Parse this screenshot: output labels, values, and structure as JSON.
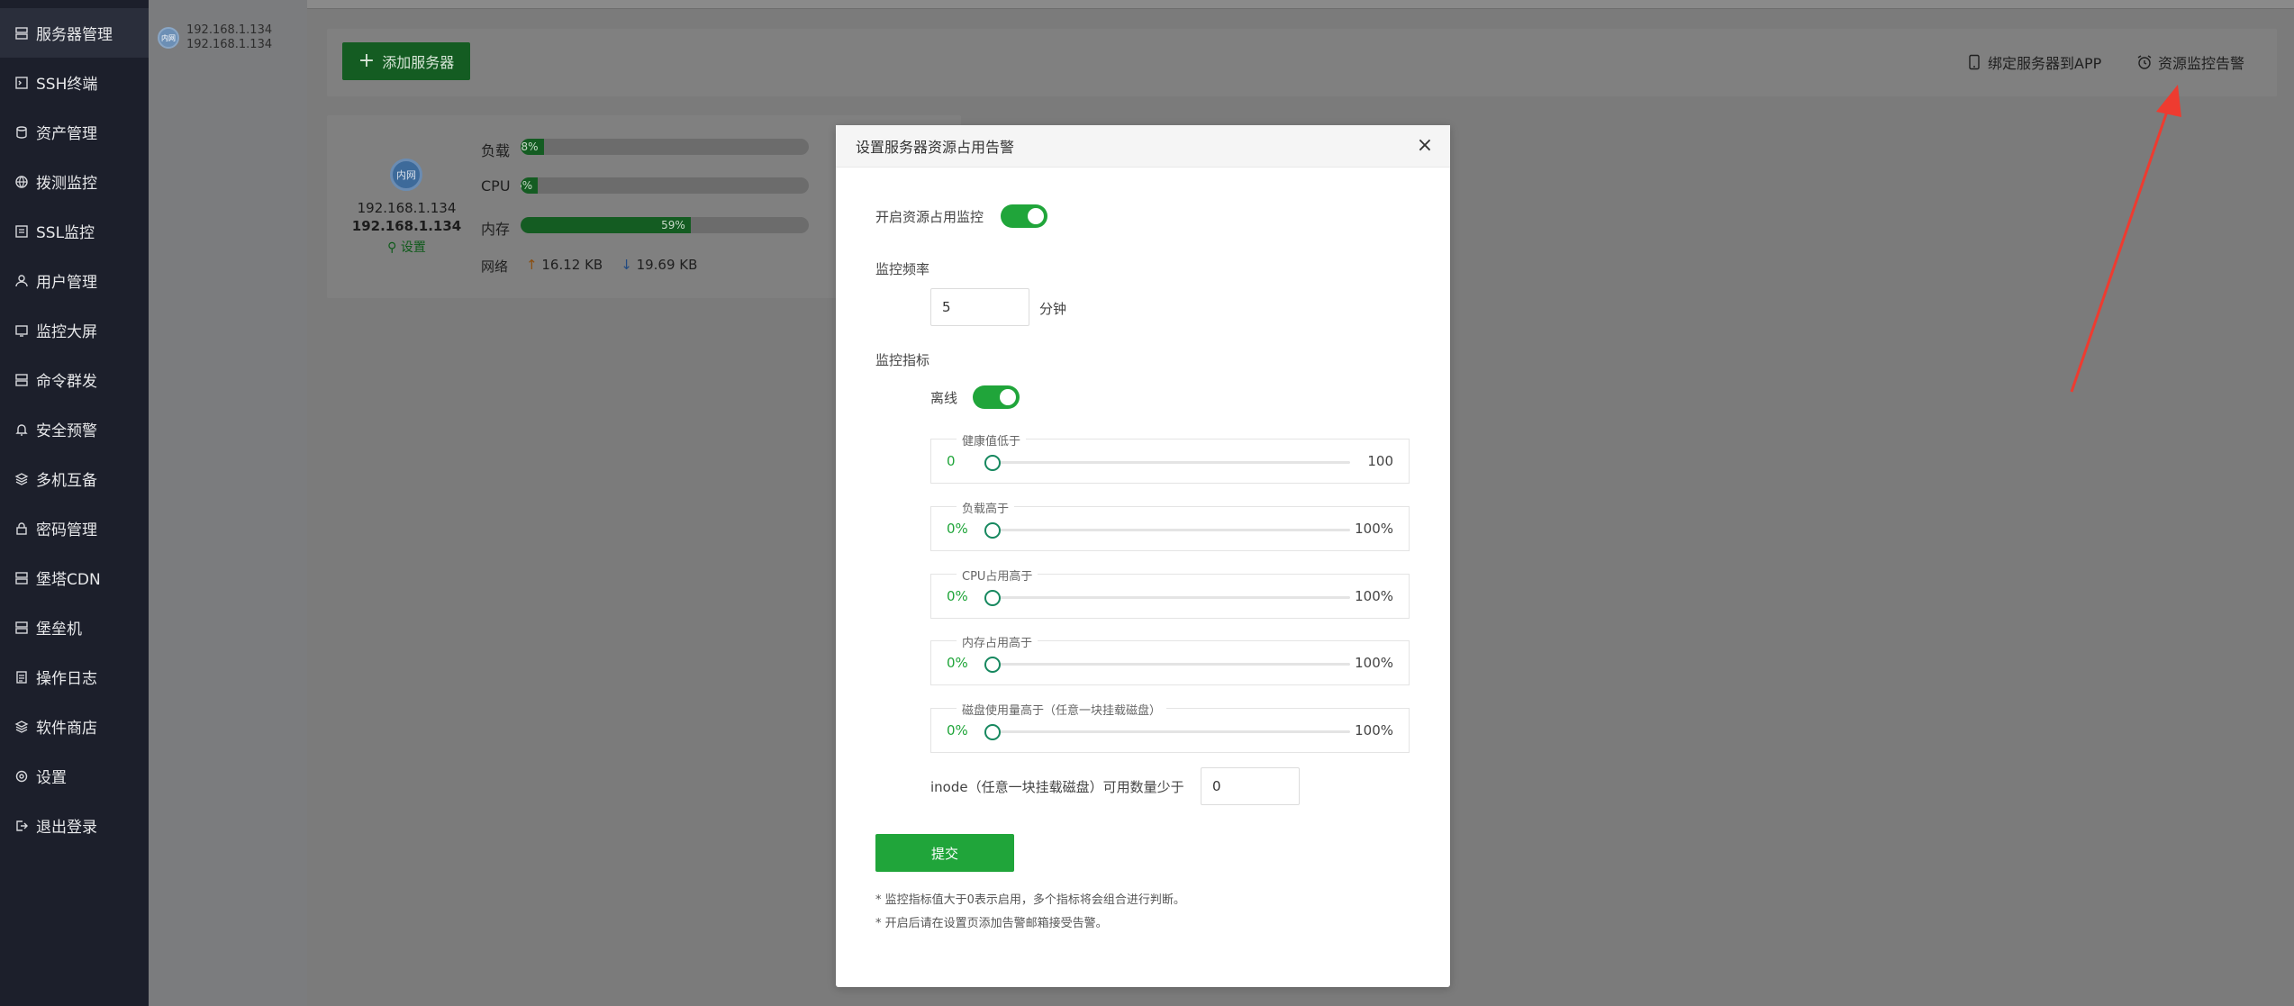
{
  "sidebar": {
    "items": [
      {
        "label": "服务器管理",
        "icon": "server-icon",
        "active": true
      },
      {
        "label": "SSH终端",
        "icon": "terminal-icon"
      },
      {
        "label": "资产管理",
        "icon": "database-icon"
      },
      {
        "label": "拨测监控",
        "icon": "globe-icon"
      },
      {
        "label": "SSL监控",
        "icon": "ssl-icon"
      },
      {
        "label": "用户管理",
        "icon": "user-icon"
      },
      {
        "label": "监控大屏",
        "icon": "dashboard-icon"
      },
      {
        "label": "命令群发",
        "icon": "command-icon"
      },
      {
        "label": "安全预警",
        "icon": "bell-icon"
      },
      {
        "label": "多机互备",
        "icon": "layers-icon"
      },
      {
        "label": "密码管理",
        "icon": "lock-icon"
      },
      {
        "label": "堡塔CDN",
        "icon": "cdn-icon"
      },
      {
        "label": "堡垒机",
        "icon": "bastion-icon"
      },
      {
        "label": "操作日志",
        "icon": "log-icon"
      },
      {
        "label": "软件商店",
        "icon": "store-icon"
      },
      {
        "label": "设置",
        "icon": "settings-icon"
      },
      {
        "label": "退出登录",
        "icon": "logout-icon"
      }
    ]
  },
  "server_list": {
    "badge": "内网",
    "ip_line1": "192.168.1.134",
    "ip_line2": "192.168.1.134"
  },
  "toolbar": {
    "add_server": "添加服务器",
    "bind_app": "绑定服务器到APP",
    "resource_alert": "资源监控告警"
  },
  "server_card": {
    "badge": "内网",
    "ip1": "192.168.1.134",
    "ip2": "192.168.1.134",
    "settings": "设置",
    "load_label": "负载",
    "load_value": "8%",
    "load_fraction": 0.08,
    "cpu_label": "CPU",
    "cpu_value": "6%",
    "cpu_fraction": 0.06,
    "mem_label": "内存",
    "mem_value": "59%",
    "mem_fraction": 0.59,
    "net_label": "网络",
    "net_up": "16.12 KB",
    "net_down": "19.69 KB"
  },
  "modal": {
    "title": "设置服务器资源占用告警",
    "enable_label": "开启资源占用监控",
    "freq_label": "监控频率",
    "freq_value": "5",
    "freq_unit": "分钟",
    "metrics_label": "监控指标",
    "offline_label": "离线",
    "ranges": [
      {
        "legend": "健康值低于",
        "min": "0",
        "max": "100",
        "value": 0
      },
      {
        "legend": "负载高于",
        "min": "0%",
        "max": "100%",
        "value": 0
      },
      {
        "legend": "CPU占用高于",
        "min": "0%",
        "max": "100%",
        "value": 0
      },
      {
        "legend": "内存占用高于",
        "min": "0%",
        "max": "100%",
        "value": 0
      },
      {
        "legend": "磁盘使用量高于（任意一块挂载磁盘）",
        "min": "0%",
        "max": "100%",
        "value": 0
      }
    ],
    "inode_label": "inode（任意一块挂载磁盘）可用数量少于",
    "inode_value": "0",
    "submit": "提交",
    "note1": "* 监控指标值大于0表示启用，多个指标将会组合进行判断。",
    "note2": "* 开启后请在设置页添加告警邮箱接受告警。"
  },
  "colors": {
    "sidebar_bg": "#1c1f2b",
    "accent_green": "#20a53a",
    "arrow_red": "#ee3b30"
  }
}
